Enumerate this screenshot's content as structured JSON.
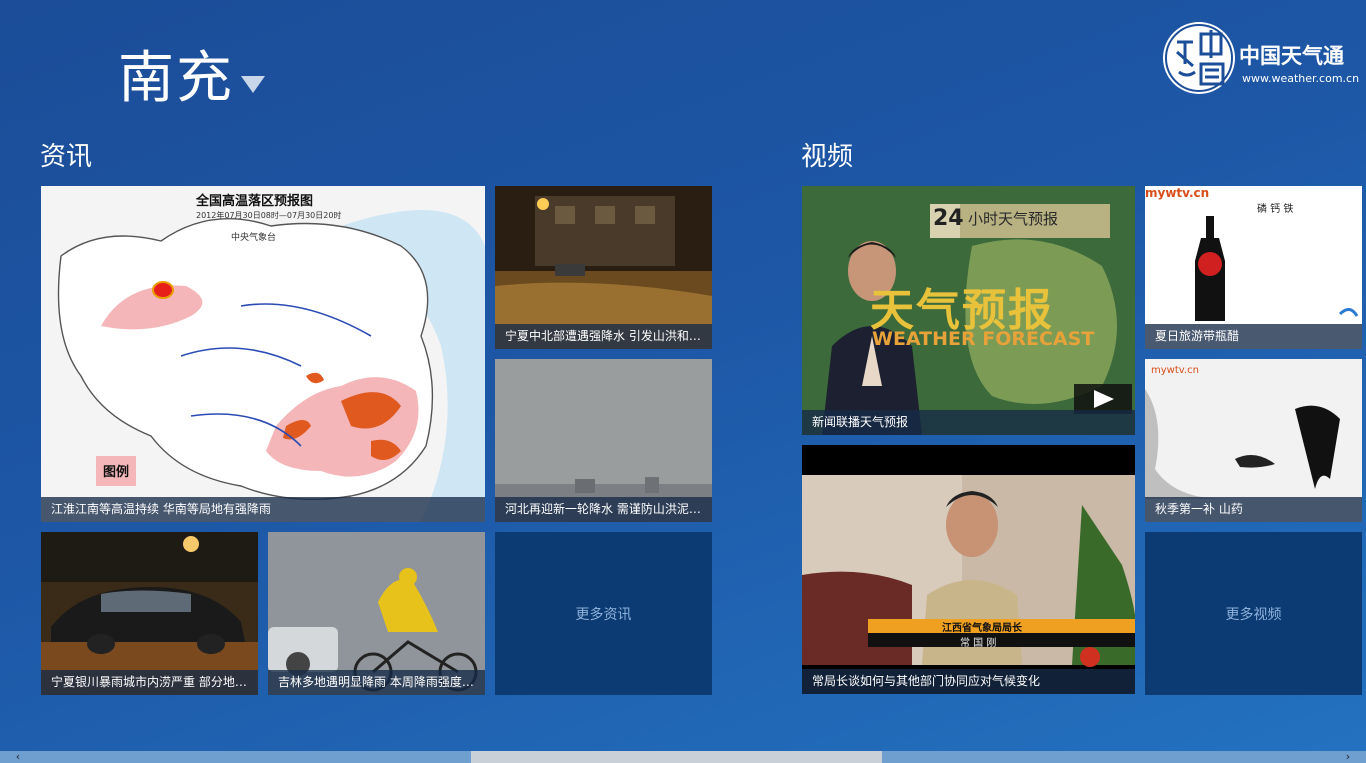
{
  "header": {
    "city": "南充",
    "brand_name": "中国天气通",
    "brand_url": "www.weather.com.cn"
  },
  "news": {
    "title": "资讯",
    "items": [
      {
        "caption": "江淮江南等高温持续 华南等局地有强降雨",
        "map_title": "全国高温落区预报图",
        "map_subtitle": "2012年07月30日08时—07月30日20时",
        "map_source": "中央气象台",
        "legend_label": "图例"
      },
      {
        "caption": "宁夏中北部遭遇强降水 引发山洪和严重内涝"
      },
      {
        "caption": "河北再迎新一轮降水 需谨防山洪泥石流"
      },
      {
        "caption": "宁夏银川暴雨城市内涝严重 部分地区积水"
      },
      {
        "caption": "吉林多地遇明显降雨 本周降雨强度将加大"
      }
    ],
    "more_label": "更多资讯"
  },
  "video": {
    "title": "视频",
    "items": [
      {
        "caption": "新闻联播天气预报",
        "badge_number": "24",
        "badge_text": "小时天气预报",
        "banner_cn": "天气预报",
        "banner_en": "WEATHER FORECAST"
      },
      {
        "caption": "夏日旅游带瓶醋",
        "site": "mywtv.cn",
        "label": "磷 钙 铁"
      },
      {
        "caption": "常局长谈如何与其他部门协同应对气候变化",
        "subtitle_title": "江西省气象局局长",
        "subtitle_name": "常 国 刚"
      },
      {
        "caption": "秋季第一补 山药",
        "site": "mywtv.cn"
      }
    ],
    "more_label": "更多视频"
  },
  "colors": {
    "background": "#1d57a6",
    "tile_more": "#0b3b72",
    "caption_bg": "#162a48"
  }
}
